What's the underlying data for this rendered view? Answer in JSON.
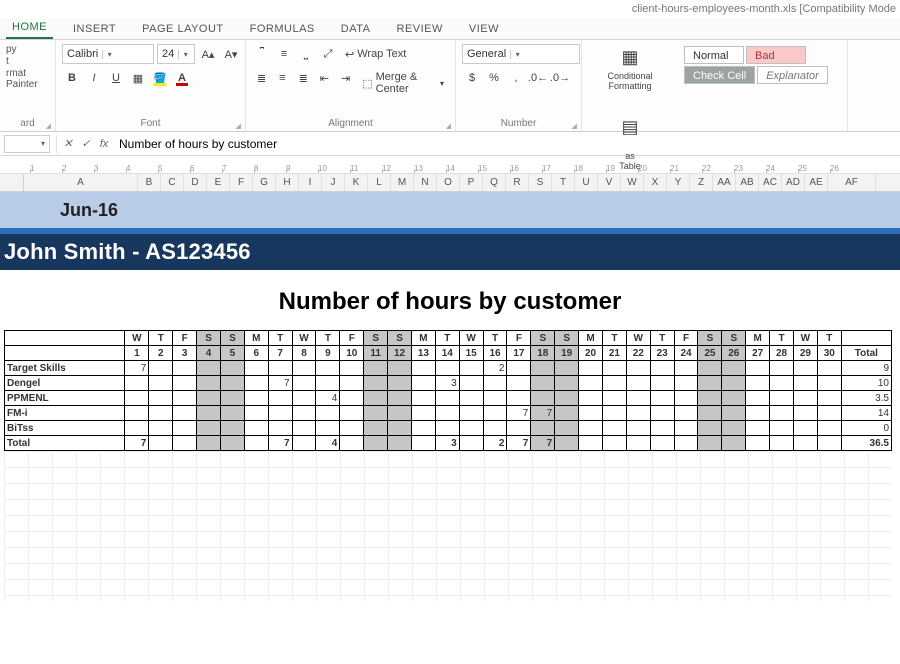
{
  "window": {
    "filename": "client-hours-employees-month.xls  [Compatibility Mode"
  },
  "tabs": [
    "HOME",
    "INSERT",
    "PAGE LAYOUT",
    "FORMULAS",
    "DATA",
    "REVIEW",
    "VIEW"
  ],
  "clipboard": {
    "copy": "py",
    "paste": "t",
    "fmtpainter": "rmat Painter",
    "label": "ard"
  },
  "font": {
    "name": "Calibri",
    "size": "24",
    "label": "Font",
    "bold": "B",
    "italic": "I",
    "underline": "U"
  },
  "alignment": {
    "wrap": "Wrap Text",
    "merge": "Merge & Center",
    "label": "Alignment"
  },
  "number": {
    "format": "General",
    "label": "Number"
  },
  "styles": {
    "cond": "Conditional Formatting",
    "fat": "Format as Table",
    "cells": [
      "Normal",
      "Bad",
      "Check Cell",
      "Explanator"
    ]
  },
  "formula_bar": {
    "value": "Number of hours by customer"
  },
  "ruler_marks": [
    "1",
    "2",
    "3",
    "4",
    "5",
    "6",
    "7",
    "8",
    "9",
    "10",
    "11",
    "12",
    "13",
    "14",
    "15",
    "16",
    "17",
    "18",
    "19",
    "20",
    "21",
    "22",
    "23",
    "24",
    "25",
    "26"
  ],
  "columns": [
    "A",
    "B",
    "C",
    "D",
    "E",
    "F",
    "G",
    "H",
    "I",
    "J",
    "K",
    "L",
    "M",
    "N",
    "O",
    "P",
    "Q",
    "R",
    "S",
    "T",
    "U",
    "V",
    "W",
    "X",
    "Y",
    "Z",
    "AA",
    "AB",
    "AC",
    "AD",
    "AE",
    "AF"
  ],
  "sheet": {
    "month": "Jun-16",
    "person": "John Smith -  AS123456",
    "title": "Number of hours by customer",
    "day_letters": [
      "W",
      "T",
      "F",
      "S",
      "S",
      "M",
      "T",
      "W",
      "T",
      "F",
      "S",
      "S",
      "M",
      "T",
      "W",
      "T",
      "F",
      "S",
      "S",
      "M",
      "T",
      "W",
      "T",
      "F",
      "S",
      "S",
      "M",
      "T",
      "W",
      "T"
    ],
    "day_nums": [
      "1",
      "2",
      "3",
      "4",
      "5",
      "6",
      "7",
      "8",
      "9",
      "10",
      "11",
      "12",
      "13",
      "14",
      "15",
      "16",
      "17",
      "18",
      "19",
      "20",
      "21",
      "22",
      "23",
      "24",
      "25",
      "26",
      "27",
      "28",
      "29",
      "30"
    ],
    "weekend_idx": [
      3,
      4,
      10,
      11,
      17,
      18,
      24,
      25
    ],
    "total_label": "Total",
    "rows": [
      {
        "label": "Target Skills",
        "cls": "c-ts",
        "cells": [
          "7",
          "",
          "",
          "",
          "",
          "",
          "",
          "",
          "",
          "",
          "",
          "",
          "",
          "",
          "",
          "2",
          "",
          "",
          "",
          "",
          "",
          "",
          "",
          "",
          "",
          "",
          "",
          "",
          "",
          ""
        ],
        "total": "9"
      },
      {
        "label": "Dengel",
        "cls": "c-de",
        "cells": [
          "",
          "",
          "",
          "",
          "",
          "",
          "7",
          "",
          "",
          "",
          "",
          "",
          "",
          "3",
          "",
          "",
          "",
          "",
          "",
          "",
          "",
          "",
          "",
          "",
          "",
          "",
          "",
          "",
          "",
          ""
        ],
        "total": "10"
      },
      {
        "label": "PPMENL",
        "cls": "c-pp",
        "cells": [
          "",
          "",
          "",
          "",
          "",
          "",
          "",
          "",
          "4",
          "",
          "",
          "",
          "",
          "",
          "",
          "",
          "",
          "",
          "",
          "",
          "",
          "",
          "",
          "",
          "",
          "",
          "",
          "",
          "",
          ""
        ],
        "total": "3.5"
      },
      {
        "label": "FM-i",
        "cls": "c-fm",
        "cells": [
          "",
          "",
          "",
          "",
          "",
          "",
          "",
          "",
          "",
          "",
          "",
          "",
          "",
          "",
          "",
          "",
          "7",
          "7",
          "",
          "",
          "",
          "",
          "",
          "",
          "",
          "",
          "",
          "",
          "",
          ""
        ],
        "total": "14"
      },
      {
        "label": "BiTss",
        "cls": "c-bi",
        "cells": [
          "",
          "",
          "",
          "",
          "",
          "",
          "",
          "",
          "",
          "",
          "",
          "",
          "",
          "",
          "",
          "",
          "",
          "",
          "",
          "",
          "",
          "",
          "",
          "",
          "",
          "",
          "",
          "",
          "",
          ""
        ],
        "total": "0"
      }
    ],
    "grand": {
      "label": "Total",
      "cells": [
        "7",
        "",
        "",
        "",
        "",
        "",
        "7",
        "",
        "4",
        "",
        "",
        "",
        "",
        "3",
        "",
        "2",
        "7",
        "7",
        "",
        "",
        "",
        "",
        "",
        "",
        "",
        "",
        "",
        "",
        "",
        ""
      ],
      "total": "36.5"
    }
  }
}
